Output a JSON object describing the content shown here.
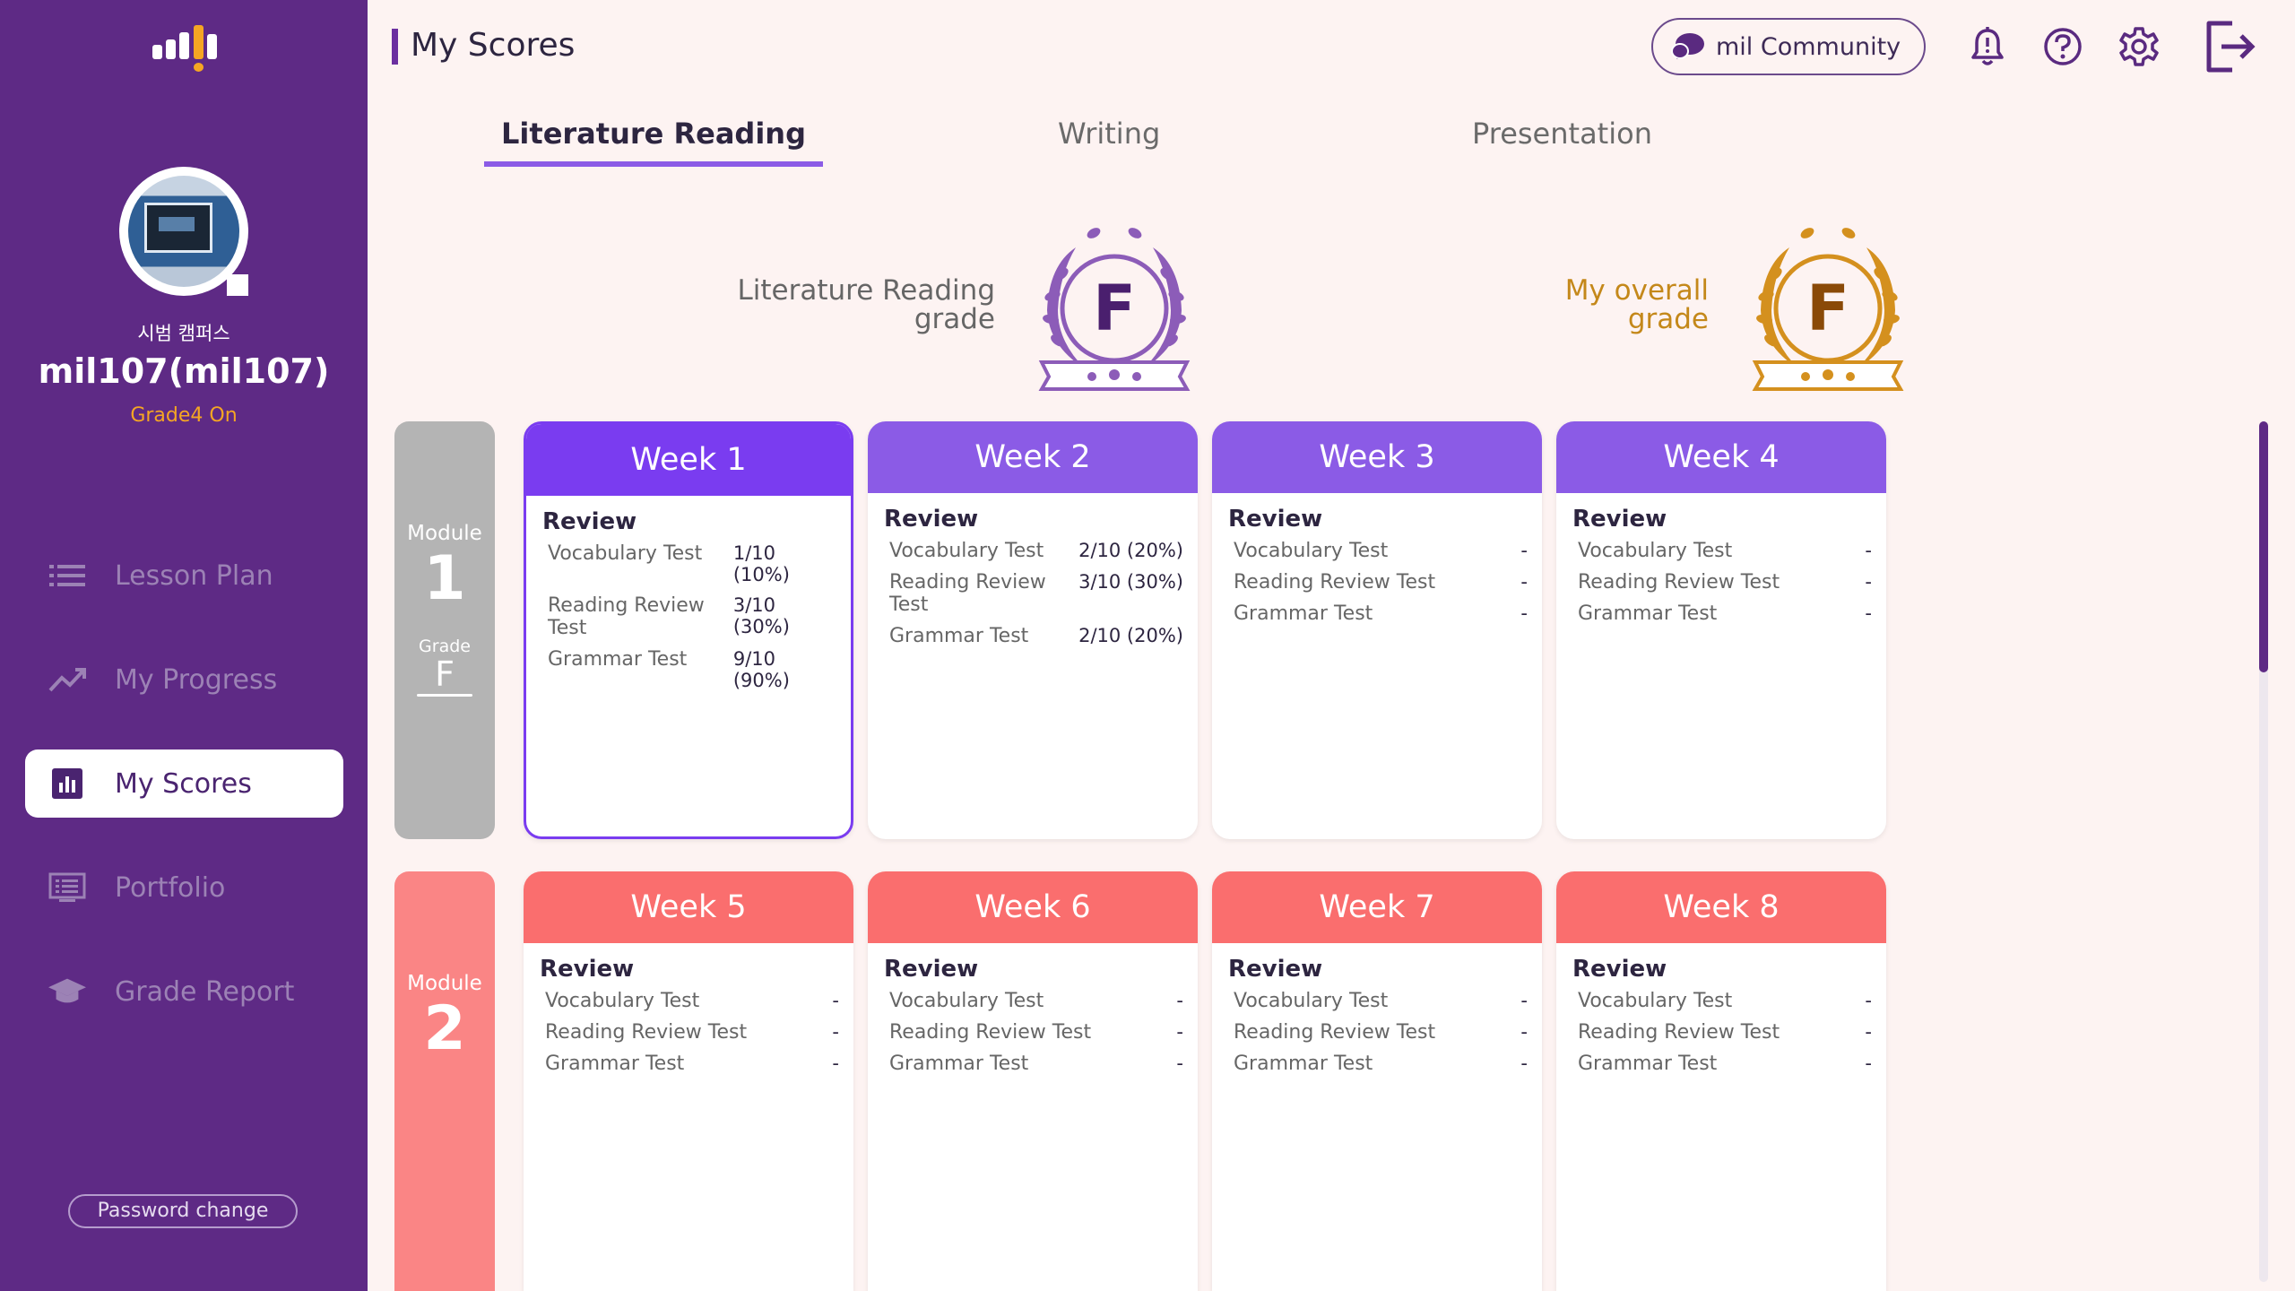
{
  "sidebar": {
    "campus": "시범 캠퍼스",
    "username": "mil107(mil107)",
    "grade_status": "Grade4 On",
    "nav": [
      {
        "label": "Lesson Plan",
        "icon": "list-icon"
      },
      {
        "label": "My Progress",
        "icon": "trend-icon"
      },
      {
        "label": "My Scores",
        "icon": "bar-chart-icon",
        "active": true
      },
      {
        "label": "Portfolio",
        "icon": "portfolio-icon"
      },
      {
        "label": "Grade Report",
        "icon": "graduation-cap-icon"
      }
    ],
    "password_change": "Password change"
  },
  "header": {
    "title": "My Scores",
    "community": "mil Community"
  },
  "tabs": [
    {
      "label": "Literature Reading",
      "active": true
    },
    {
      "label": "Writing"
    },
    {
      "label": "Presentation"
    }
  ],
  "grades": {
    "literature_label_1": "Literature Reading",
    "literature_label_2": "grade",
    "literature_value": "F",
    "overall_label_1": "My overall",
    "overall_label_2": "grade",
    "overall_value": "F"
  },
  "modules": [
    {
      "label": "Module",
      "number": "1",
      "grade_label": "Grade",
      "grade": "F"
    },
    {
      "label": "Module",
      "number": "2"
    }
  ],
  "review_label": "Review",
  "test_names": {
    "vocab": "Vocabulary Test",
    "reading": "Reading Review Test",
    "grammar": "Grammar Test"
  },
  "weeks": [
    {
      "title": "Week 1",
      "vocab": "1/10 (10%)",
      "reading": "3/10 (30%)",
      "grammar": "9/10 (90%)"
    },
    {
      "title": "Week 2",
      "vocab": "2/10 (20%)",
      "reading": "3/10 (30%)",
      "grammar": "2/10 (20%)"
    },
    {
      "title": "Week 3",
      "vocab": "-",
      "reading": "-",
      "grammar": "-"
    },
    {
      "title": "Week 4",
      "vocab": "-",
      "reading": "-",
      "grammar": "-"
    },
    {
      "title": "Week 5",
      "vocab": "-",
      "reading": "-",
      "grammar": "-"
    },
    {
      "title": "Week 6",
      "vocab": "-",
      "reading": "-",
      "grammar": "-"
    },
    {
      "title": "Week 7",
      "vocab": "-",
      "reading": "-",
      "grammar": "-"
    },
    {
      "title": "Week 8",
      "vocab": "-",
      "reading": "-",
      "grammar": "-"
    }
  ],
  "colors": {
    "sidebar": "#5e2a85",
    "accent_purple": "#8b5be6",
    "module2_red": "#fa6e6e",
    "grade_purple": "#7a4aa6",
    "grade_gold": "#d4901e"
  }
}
